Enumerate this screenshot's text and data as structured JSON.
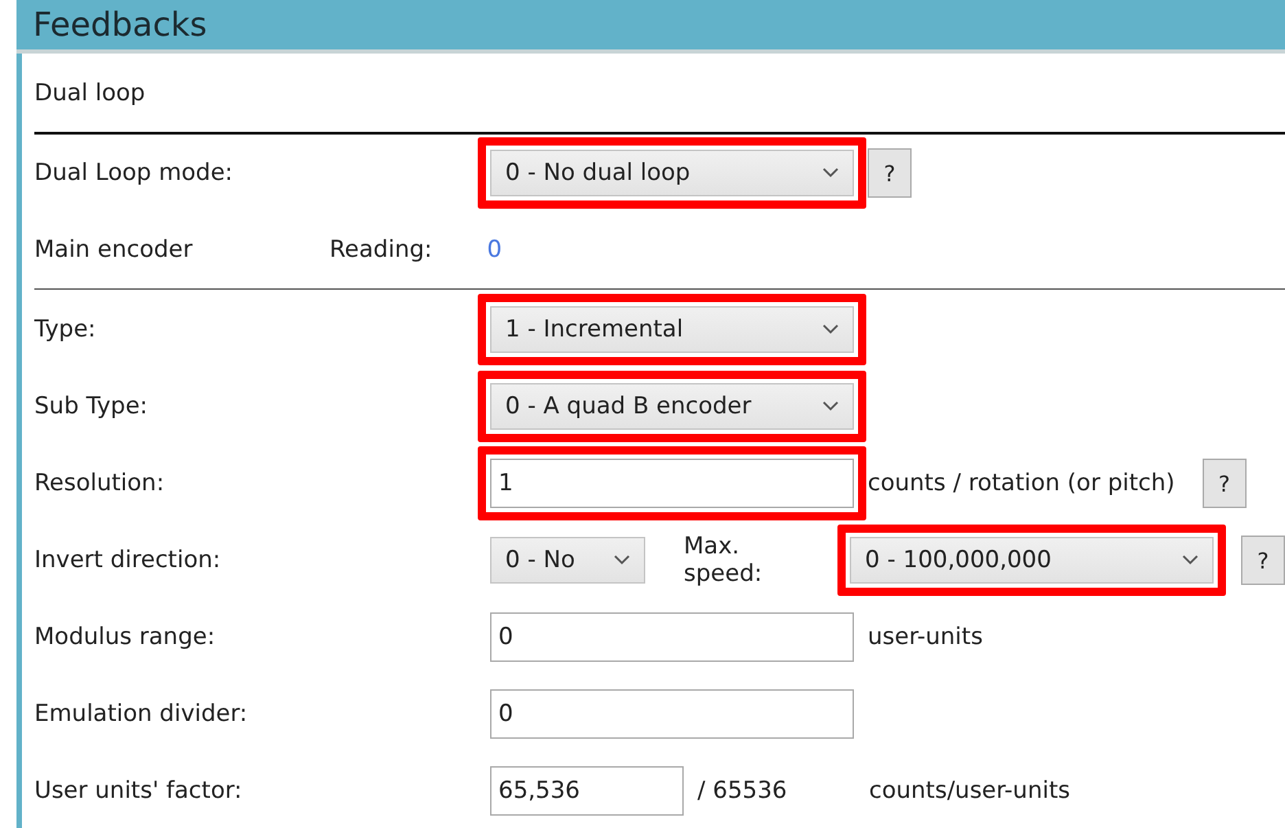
{
  "window": {
    "title": "Feedbacks"
  },
  "rows": [
    {
      "kind": "section",
      "label": "Dual loop"
    },
    {
      "kind": "field",
      "label": "Dual Loop mode:",
      "controls": [
        {
          "kind": "dropdown",
          "value": "0 - No dual loop",
          "highlighted": true
        },
        {
          "kind": "help",
          "text": "?"
        }
      ]
    },
    {
      "kind": "header",
      "label": "Main encoder",
      "controls": [
        {
          "kind": "caption",
          "text": "Reading:"
        },
        {
          "kind": "reading",
          "text": "0"
        }
      ]
    },
    {
      "kind": "field",
      "label": "Type:",
      "controls": [
        {
          "kind": "dropdown",
          "value": "1 - Incremental",
          "highlighted": true
        }
      ]
    },
    {
      "kind": "field",
      "label": "Sub Type:",
      "controls": [
        {
          "kind": "dropdown",
          "value": "0 - A quad B encoder",
          "highlighted": true
        }
      ]
    },
    {
      "kind": "field",
      "label": "Resolution:",
      "controls": [
        {
          "kind": "input",
          "value": "1",
          "highlighted": true
        },
        {
          "kind": "unit",
          "text": "counts / rotation (or pitch)"
        },
        {
          "kind": "help",
          "text": "?"
        }
      ]
    },
    {
      "kind": "field",
      "label": "Invert direction:",
      "controls": [
        {
          "kind": "small-dropdown",
          "value": "0 - No",
          "highlighted": false
        },
        {
          "kind": "caption",
          "text": "Max. speed:"
        },
        {
          "kind": "dropdown",
          "value": "0 - 100,000,000",
          "highlighted": true
        },
        {
          "kind": "help",
          "text": "?"
        }
      ]
    },
    {
      "kind": "field",
      "label": "Modulus range:",
      "controls": [
        {
          "kind": "input",
          "value": "0",
          "highlighted": false
        },
        {
          "kind": "unit",
          "text": "user-units"
        }
      ]
    },
    {
      "kind": "field",
      "label": "Emulation divider:",
      "controls": [
        {
          "kind": "input",
          "value": "0",
          "highlighted": false
        }
      ]
    },
    {
      "kind": "field",
      "label": "User units' factor:",
      "controls": [
        {
          "kind": "small-input",
          "value": "65,536",
          "highlighted": false
        },
        {
          "kind": "ratio",
          "text": "/ 65536"
        },
        {
          "kind": "unit",
          "text": "counts/user-units"
        }
      ]
    }
  ]
}
